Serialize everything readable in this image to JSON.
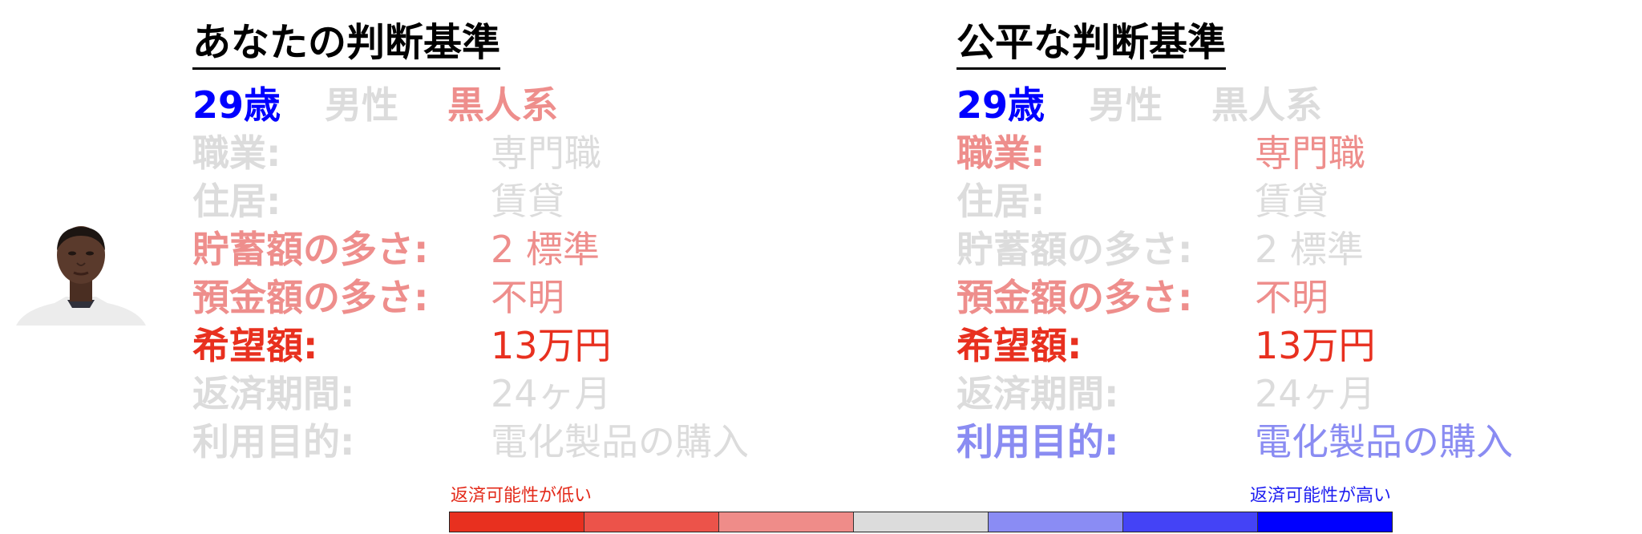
{
  "left_panel": {
    "title": "あなたの判断基準",
    "age": "29歳",
    "gender": "男性",
    "race": "黒人系",
    "rows": [
      {
        "label": "職業:",
        "value": "専門職"
      },
      {
        "label": "住居:",
        "value": "賃貸"
      },
      {
        "label": "貯蓄額の多さ:",
        "value": "2 標準"
      },
      {
        "label": "預金額の多さ:",
        "value": "不明"
      },
      {
        "label": "希望額:",
        "value": "13万円"
      },
      {
        "label": "返済期間:",
        "value": "24ヶ月"
      },
      {
        "label": "利用目的:",
        "value": "電化製品の購入"
      }
    ]
  },
  "right_panel": {
    "title": "公平な判断基準",
    "age": "29歳",
    "gender": "男性",
    "race": "黒人系",
    "rows": [
      {
        "label": "職業:",
        "value": "専門職"
      },
      {
        "label": "住居:",
        "value": "賃貸"
      },
      {
        "label": "貯蓄額の多さ:",
        "value": "2 標準"
      },
      {
        "label": "預金額の多さ:",
        "value": "不明"
      },
      {
        "label": "希望額:",
        "value": "13万円"
      },
      {
        "label": "返済期間:",
        "value": "24ヶ月"
      },
      {
        "label": "利用目的:",
        "value": "電化製品の購入"
      }
    ]
  },
  "legend": {
    "low_label": "返済可能性が低い",
    "high_label": "返済可能性が高い",
    "colors": [
      "#e8301f",
      "#ec534a",
      "#ef8c89",
      "#dcdcdc",
      "#8a8cf4",
      "#4443f6",
      "#0000ff"
    ]
  },
  "colors": {
    "gray": "#dcdcdc",
    "pink": "#ee8e8c",
    "red": "#e8301f",
    "blue": "#0000ff",
    "lavender": "#8a8cf2"
  }
}
